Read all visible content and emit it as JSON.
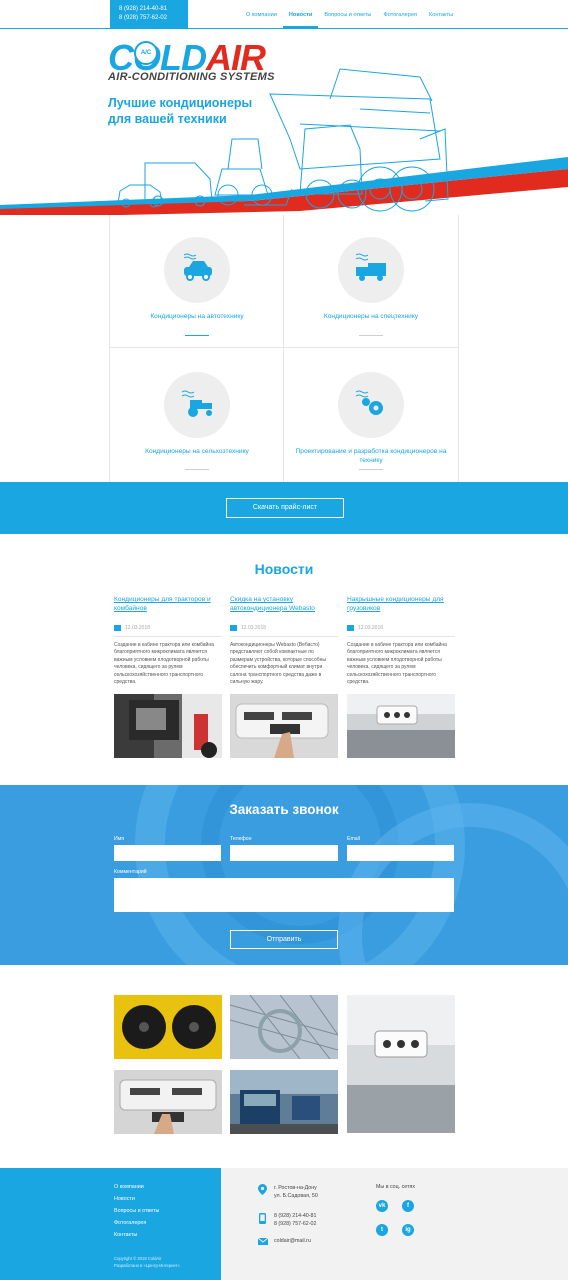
{
  "header": {
    "phones": [
      "8 (928) 214-40-81",
      "8 (928) 757-62-02"
    ],
    "nav": [
      {
        "label": "О компании",
        "active": false
      },
      {
        "label": "Новости",
        "active": true
      },
      {
        "label": "Вопросы и ответы",
        "active": false
      },
      {
        "label": "Фотогалерея",
        "active": false
      },
      {
        "label": "Контакты",
        "active": false
      }
    ]
  },
  "hero": {
    "logo_main": "COLD",
    "logo_accent": "AIR",
    "logo_badge": "A/C",
    "logo_sub": "AIR-CONDITIONING SYSTEMS",
    "title": "Лучшие кондиционеры для вашей техники"
  },
  "services": [
    {
      "label": "Кондиционеры на автотехнику",
      "icon": "car-icon"
    },
    {
      "label": "Кондиционеры на спецтехнику",
      "icon": "truck-icon"
    },
    {
      "label": "Кондиционеры на сельхозтехнику",
      "icon": "tractor-icon"
    },
    {
      "label": "Проектирование и разработка кондиционеров на технику",
      "icon": "gears-icon"
    }
  ],
  "price_button": "Скачать прайс-лист",
  "news": {
    "title": "Новости",
    "items": [
      {
        "title": "Кондиционеры для тракторов и комбайнов",
        "date": "12.03.2018",
        "text": "Создание в кабине трактора или комбайна благоприятного микроклимата является важным условием плодотворной работы человека, сидящего за рулем сельскохозяйственного транспортного средства."
      },
      {
        "title": "Скидка на установку автокондиционера Webasto",
        "date": "12.03.2018",
        "text": "Автокондиционеры Webasto (Вебасто) представляют собой компактные по размерам устройства, которые способны обеспечить комфортный климат внутри салона транспортного средства даже в сильную жару."
      },
      {
        "title": "Накрышные кондиционеры для грузовиков",
        "date": "12.03.2018",
        "text": "Создание в кабине трактора или комбайна благоприятного микроклимата является важным условием плодотворной работы человека, сидящего за рулем сельскохозяйственного транспортного средства."
      }
    ]
  },
  "callback": {
    "title": "Заказать звонок",
    "name_label": "Имя",
    "phone_label": "Телефон",
    "email_label": "Email",
    "comment_label": "Комментарий",
    "submit": "Отправить"
  },
  "footer": {
    "links": [
      "О компании",
      "Новости",
      "Вопросы и ответы",
      "Фотогалерея",
      "Контакты"
    ],
    "copyright": "Copyright © 2018 ColdAir",
    "developer": "Разработано в «Центр-Интернет»",
    "address": [
      "г. Ростов-на-Дону",
      "ул. Б.Садовая, 50"
    ],
    "phones": [
      "8 (928) 214-40-81",
      "8 (928) 757-62-02"
    ],
    "email": "coldair@mail.ru",
    "social_label": "Мы в соц. сетях",
    "social": [
      {
        "icon": "vk-icon",
        "glyph": "vk"
      },
      {
        "icon": "facebook-icon",
        "glyph": "f"
      },
      {
        "icon": "twitter-icon",
        "glyph": "t"
      },
      {
        "icon": "instagram-icon",
        "glyph": "ig"
      }
    ]
  },
  "colors": {
    "accent": "#19a6e1",
    "brand_red": "#e02b1e",
    "light_gray": "#f2f2f2"
  }
}
